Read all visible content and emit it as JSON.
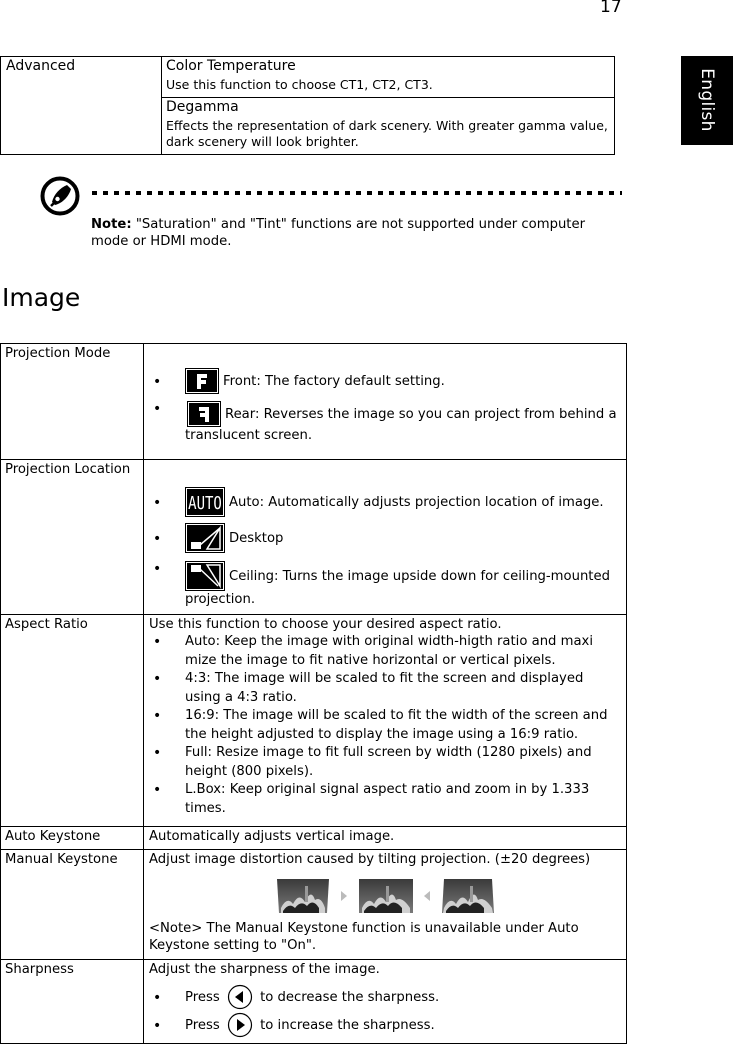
{
  "page": {
    "number": "17",
    "language_tab": "English"
  },
  "advanced_table": {
    "label": "Advanced",
    "items": [
      {
        "title": "Color Temperature",
        "text": "Use this function to choose CT1, CT2, CT3."
      },
      {
        "title": "Degamma",
        "text": "Effects the representation of dark scenery. With greater gamma value, dark scenery will look brighter."
      }
    ]
  },
  "note": {
    "icon": "note-pen-icon",
    "label": "Note:",
    "text": " \"Saturation\" and \"Tint\" functions are not supported under computer mode or HDMI mode."
  },
  "section": {
    "title": "Image"
  },
  "image_table": {
    "projection_mode": {
      "label": "Projection Mode",
      "items": [
        {
          "icon": "front-projection-icon",
          "text": "Front: The factory default setting."
        },
        {
          "icon": "rear-projection-icon",
          "text": "Rear: Reverses the image so you can project from behind a translucent screen."
        }
      ]
    },
    "projection_location": {
      "label": "Projection Location",
      "items": [
        {
          "icon": "auto-location-icon",
          "icon_text": "AUTO",
          "text": "Auto: Automatically adjusts projection location of image."
        },
        {
          "icon": "desktop-location-icon",
          "text": "Desktop"
        },
        {
          "icon": "ceiling-location-icon",
          "text": "Ceiling: Turns the image upside down for ceiling-mounted projection."
        }
      ]
    },
    "aspect_ratio": {
      "label": "Aspect Ratio",
      "intro": "Use this function to choose your desired aspect ratio.",
      "items": [
        "Auto: Keep the image with original width-higth ratio and maxi mize the image to fit native horizontal or vertical pixels.",
        "4:3: The image will be scaled to fit the screen and displayed using a 4:3 ratio.",
        "16:9: The image will be scaled to fit the width of the screen and the height adjusted to display the image using a 16:9 ratio.",
        "Full: Resize image to fit full screen by width (1280 pixels) and height (800 pixels).",
        "L.Box: Keep original signal aspect ratio and zoom in by 1.333 times."
      ]
    },
    "auto_keystone": {
      "label": "Auto Keystone",
      "text": "Automatically adjusts vertical image."
    },
    "manual_keystone": {
      "label": "Manual Keystone",
      "text": "Adjust image distortion caused by tilting projection. (±20 degrees)",
      "illustration": [
        "keystone-wide-top-image",
        "right-arrow-icon",
        "keystone-normal-image",
        "left-arrow-icon",
        "keystone-wide-bottom-image"
      ],
      "note": "<Note> The Manual Keystone function is unavailable under Auto Keystone setting to \"On\"."
    },
    "sharpness": {
      "label": "Sharpness",
      "text": "Adjust the sharpness of the image.",
      "items": [
        {
          "prefix": "Press",
          "icon": "left-arrow-button-icon",
          "suffix": "to decrease the sharpness."
        },
        {
          "prefix": "Press",
          "icon": "right-arrow-button-icon",
          "suffix": "to increase the sharpness."
        }
      ]
    }
  }
}
